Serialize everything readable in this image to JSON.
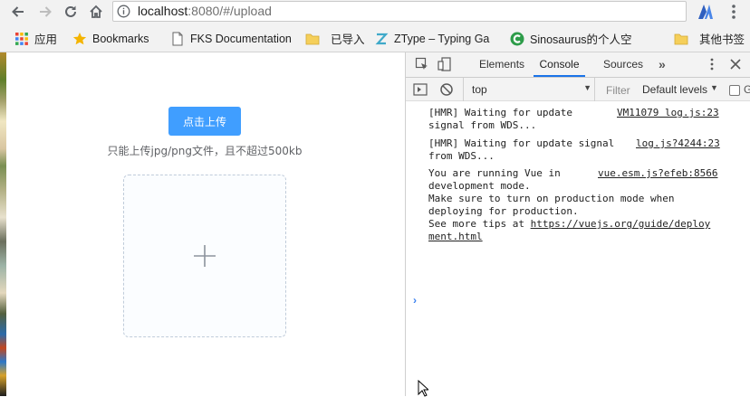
{
  "browser": {
    "url": {
      "host": "localhost",
      "rest": ":8080/#/upload"
    }
  },
  "bookmarks": [
    {
      "label": "应用",
      "icon": "apps-grid-icon"
    },
    {
      "label": "Bookmarks",
      "icon": "star-icon"
    },
    {
      "label": "FKS Documentation",
      "icon": "page-icon"
    },
    {
      "label": "已导入",
      "icon": "folder-icon"
    },
    {
      "label": "ZType – Typing Ga",
      "icon": "ztype-icon"
    },
    {
      "label": "Sinosaurus的个人空",
      "icon": "sinosaurus-icon"
    },
    {
      "label": "其他书签",
      "icon": "folder-icon"
    }
  ],
  "page": {
    "upload_button": "点击上传",
    "tip": "只能上传jpg/png文件，且不超过500kb"
  },
  "devtools": {
    "tabs": [
      "Elements",
      "Console",
      "Sources"
    ],
    "active_tab": "Console",
    "context": "top",
    "filter_placeholder": "Filter",
    "levels": "Default levels",
    "messages": [
      {
        "text": "[HMR] Waiting for update\nsignal from WDS...",
        "source": "VM11079 log.js:23"
      },
      {
        "text": "[HMR] Waiting for update signal\nfrom WDS...",
        "source": "log.js?4244:23"
      },
      {
        "text_pre": "You are running Vue in\ndevelopment mode.\nMake sure to turn on production mode when\ndeploying for production.\nSee more tips at ",
        "link": "https://vuejs.org/guide/deployment.html",
        "source": "vue.esm.js?efeb:8566"
      }
    ]
  }
}
